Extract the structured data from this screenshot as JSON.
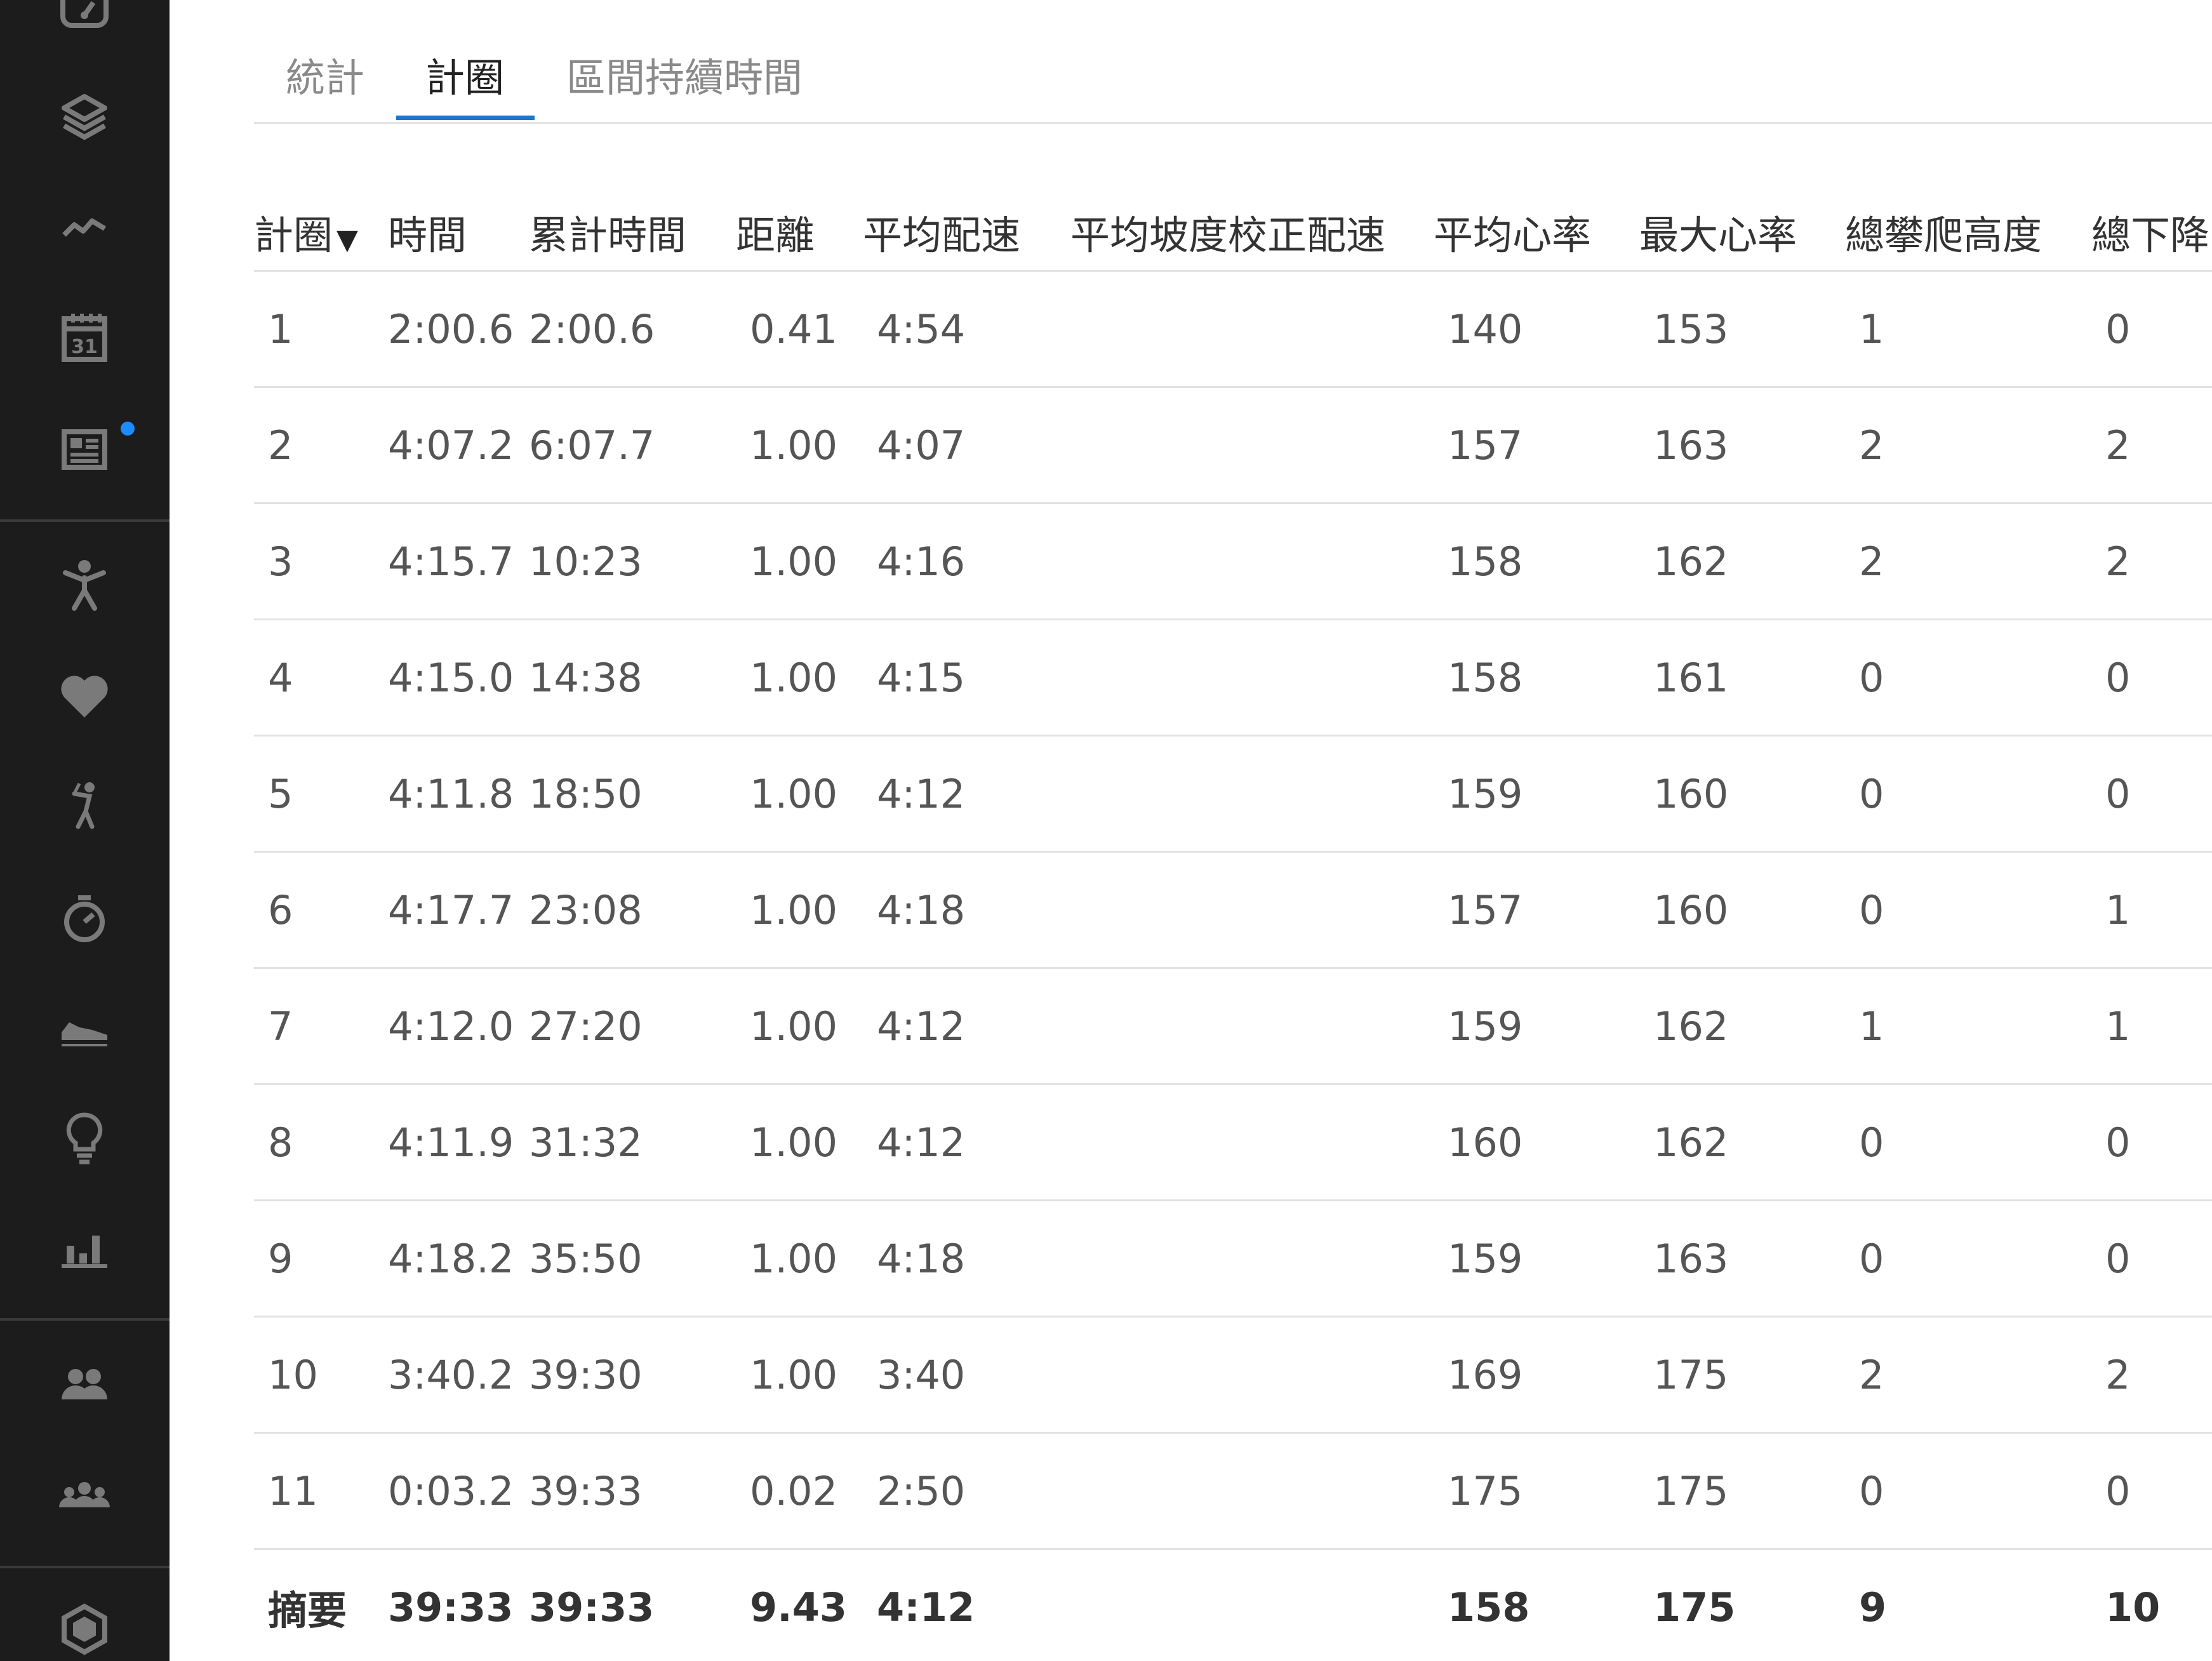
{
  "tabs": [
    {
      "label": "統計",
      "active": false
    },
    {
      "label": "計圈",
      "active": true
    },
    {
      "label": "區間持續時間",
      "active": false
    }
  ],
  "accent_color": "#1976d2",
  "sidebar": {
    "icons": [
      "dashboard-icon",
      "layers-icon",
      "activity-line-icon",
      "calendar-icon",
      "news-icon",
      "stretch-person-icon",
      "heart-icon",
      "golf-icon",
      "stopwatch-icon",
      "shoe-icon",
      "lightbulb-icon",
      "bar-chart-icon",
      "friends-icon",
      "groups-icon",
      "hexagon-icon"
    ],
    "calendar_day": "31",
    "notification_color": "#1a8cff"
  },
  "table": {
    "sort_indicator": "▼",
    "columns": [
      "計圈",
      "時間",
      "累計時間",
      "距離",
      "平均配速",
      "平均坡度校正配速",
      "平均心率",
      "最大心率",
      "總攀爬高度",
      "總下降"
    ],
    "rows": [
      [
        "1",
        "2:00.6",
        "2:00.6",
        "0.41",
        "4:54",
        "",
        "140",
        "153",
        "1",
        "0"
      ],
      [
        "2",
        "4:07.2",
        "6:07.7",
        "1.00",
        "4:07",
        "",
        "157",
        "163",
        "2",
        "2"
      ],
      [
        "3",
        "4:15.7",
        "10:23",
        "1.00",
        "4:16",
        "",
        "158",
        "162",
        "2",
        "2"
      ],
      [
        "4",
        "4:15.0",
        "14:38",
        "1.00",
        "4:15",
        "",
        "158",
        "161",
        "0",
        "0"
      ],
      [
        "5",
        "4:11.8",
        "18:50",
        "1.00",
        "4:12",
        "",
        "159",
        "160",
        "0",
        "0"
      ],
      [
        "6",
        "4:17.7",
        "23:08",
        "1.00",
        "4:18",
        "",
        "157",
        "160",
        "0",
        "1"
      ],
      [
        "7",
        "4:12.0",
        "27:20",
        "1.00",
        "4:12",
        "",
        "159",
        "162",
        "1",
        "1"
      ],
      [
        "8",
        "4:11.9",
        "31:32",
        "1.00",
        "4:12",
        "",
        "160",
        "162",
        "0",
        "0"
      ],
      [
        "9",
        "4:18.2",
        "35:50",
        "1.00",
        "4:18",
        "",
        "159",
        "163",
        "0",
        "0"
      ],
      [
        "10",
        "3:40.2",
        "39:30",
        "1.00",
        "3:40",
        "",
        "169",
        "175",
        "2",
        "2"
      ],
      [
        "11",
        "0:03.2",
        "39:33",
        "0.02",
        "2:50",
        "",
        "175",
        "175",
        "0",
        "0"
      ]
    ],
    "summary": [
      "摘要",
      "39:33",
      "39:33",
      "9.43",
      "4:12",
      "",
      "158",
      "175",
      "9",
      "10"
    ]
  }
}
